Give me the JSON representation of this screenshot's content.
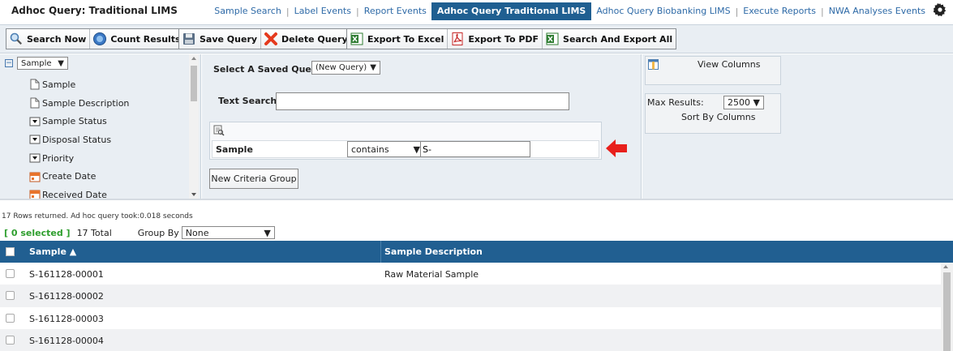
{
  "app": {
    "title": "Adhoc Query: Traditional LIMS"
  },
  "topnav": {
    "items": [
      {
        "label": "Sample Search",
        "active": false
      },
      {
        "label": "Label Events",
        "active": false
      },
      {
        "label": "Report Events",
        "active": false
      },
      {
        "label": "Adhoc Query Traditional LIMS",
        "active": true
      },
      {
        "label": "Adhoc Query Biobanking LIMS",
        "active": false
      },
      {
        "label": "Execute Reports",
        "active": false
      },
      {
        "label": "NWA Analyses Events",
        "active": false
      }
    ],
    "separator": "|",
    "settings_icon": "gear-icon"
  },
  "toolbar": {
    "search_now": "Search Now",
    "count_results": "Count Results",
    "save_query": "Save Query",
    "delete_query": "Delete Query",
    "export_excel": "Export To Excel",
    "export_pdf": "Export To PDF",
    "search_export_all": "Search And Export All"
  },
  "tree": {
    "entity": "Sample",
    "items": [
      {
        "label": "Sample",
        "icon": "document-icon"
      },
      {
        "label": "Sample Description",
        "icon": "document-icon"
      },
      {
        "label": "Sample Status",
        "icon": "dropdown-icon"
      },
      {
        "label": "Disposal Status",
        "icon": "dropdown-icon"
      },
      {
        "label": "Priority",
        "icon": "dropdown-icon"
      },
      {
        "label": "Create Date",
        "icon": "calendar-icon"
      },
      {
        "label": "Received Date",
        "icon": "calendar-icon"
      }
    ]
  },
  "criteria": {
    "saved_query_label": "Select A Saved Query:",
    "saved_query_value": "(New Query)",
    "text_search_label": "Text Search",
    "text_search_value": "",
    "row": {
      "field": "Sample",
      "operator": "contains",
      "value": "S-"
    },
    "new_group_button": "New Criteria Group"
  },
  "right_panel": {
    "view_columns": "View Columns",
    "max_results_label": "Max Results:",
    "max_results_value": "2500",
    "sort_by_columns": "Sort By Columns"
  },
  "results": {
    "info": "17 Rows returned. Ad hoc query took:0.018 seconds",
    "selected": "[ 0 selected ]",
    "total": "17 Total",
    "group_by_label": "Group By",
    "group_by_value": "None",
    "columns": {
      "sample": "Sample",
      "sample_sort_indicator": "▲",
      "description": "Sample Description"
    },
    "rows": [
      {
        "sample": "S-161128-00001",
        "description": "Raw Material Sample"
      },
      {
        "sample": "S-161128-00002",
        "description": ""
      },
      {
        "sample": "S-161128-00003",
        "description": ""
      },
      {
        "sample": "S-161128-00004",
        "description": ""
      }
    ]
  },
  "colors": {
    "nav_active_bg": "#1f5f91",
    "grid_header_bg": "#215f91",
    "panel_bg": "#e9eef3",
    "selected_text": "#2e9e2e",
    "callout_arrow": "#e8201c"
  }
}
